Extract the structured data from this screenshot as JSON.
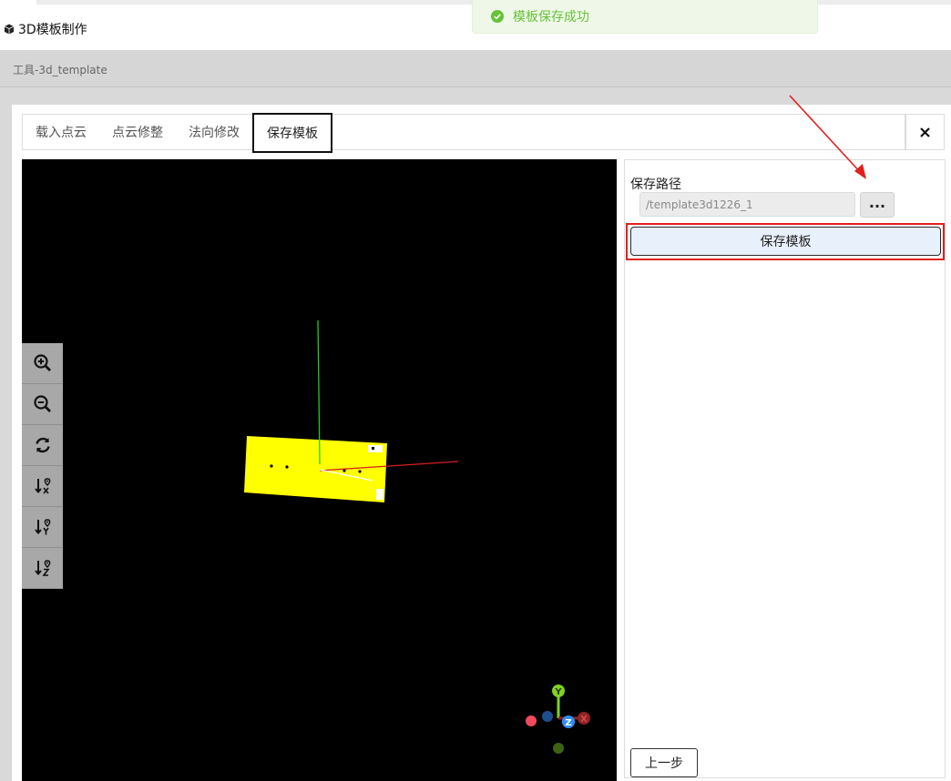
{
  "app": {
    "title": "3D模板制作",
    "icon": "cube-icon"
  },
  "toast": {
    "message": "模板保存成功",
    "icon": "check-circle-icon",
    "color": "#67c23a"
  },
  "breadcrumb": {
    "label": "工具-3d_template"
  },
  "tabs": [
    {
      "label": "载入点云",
      "active": false
    },
    {
      "label": "点云修整",
      "active": false
    },
    {
      "label": "法向修改",
      "active": false
    },
    {
      "label": "保存模板",
      "active": true
    }
  ],
  "close": {
    "icon": "close-icon"
  },
  "viewer_tools": [
    {
      "name": "zoom-in-icon"
    },
    {
      "name": "zoom-out-icon"
    },
    {
      "name": "reset-view-icon"
    },
    {
      "name": "view-along-x-icon"
    },
    {
      "name": "view-along-y-icon"
    },
    {
      "name": "view-along-z-icon"
    }
  ],
  "axis_gizmo": {
    "x": "X",
    "y": "Y",
    "z": "Z"
  },
  "side": {
    "path_label": "保存路径",
    "path_value": "/template3d1226_1",
    "browse_label": "...",
    "save_label": "保存模板",
    "prev_label": "上一步"
  },
  "colors": {
    "highlight": "#e02020",
    "pointcloud": "#ffff00",
    "x_axis": "#d11f1f",
    "y_axis": "#22cc22"
  }
}
